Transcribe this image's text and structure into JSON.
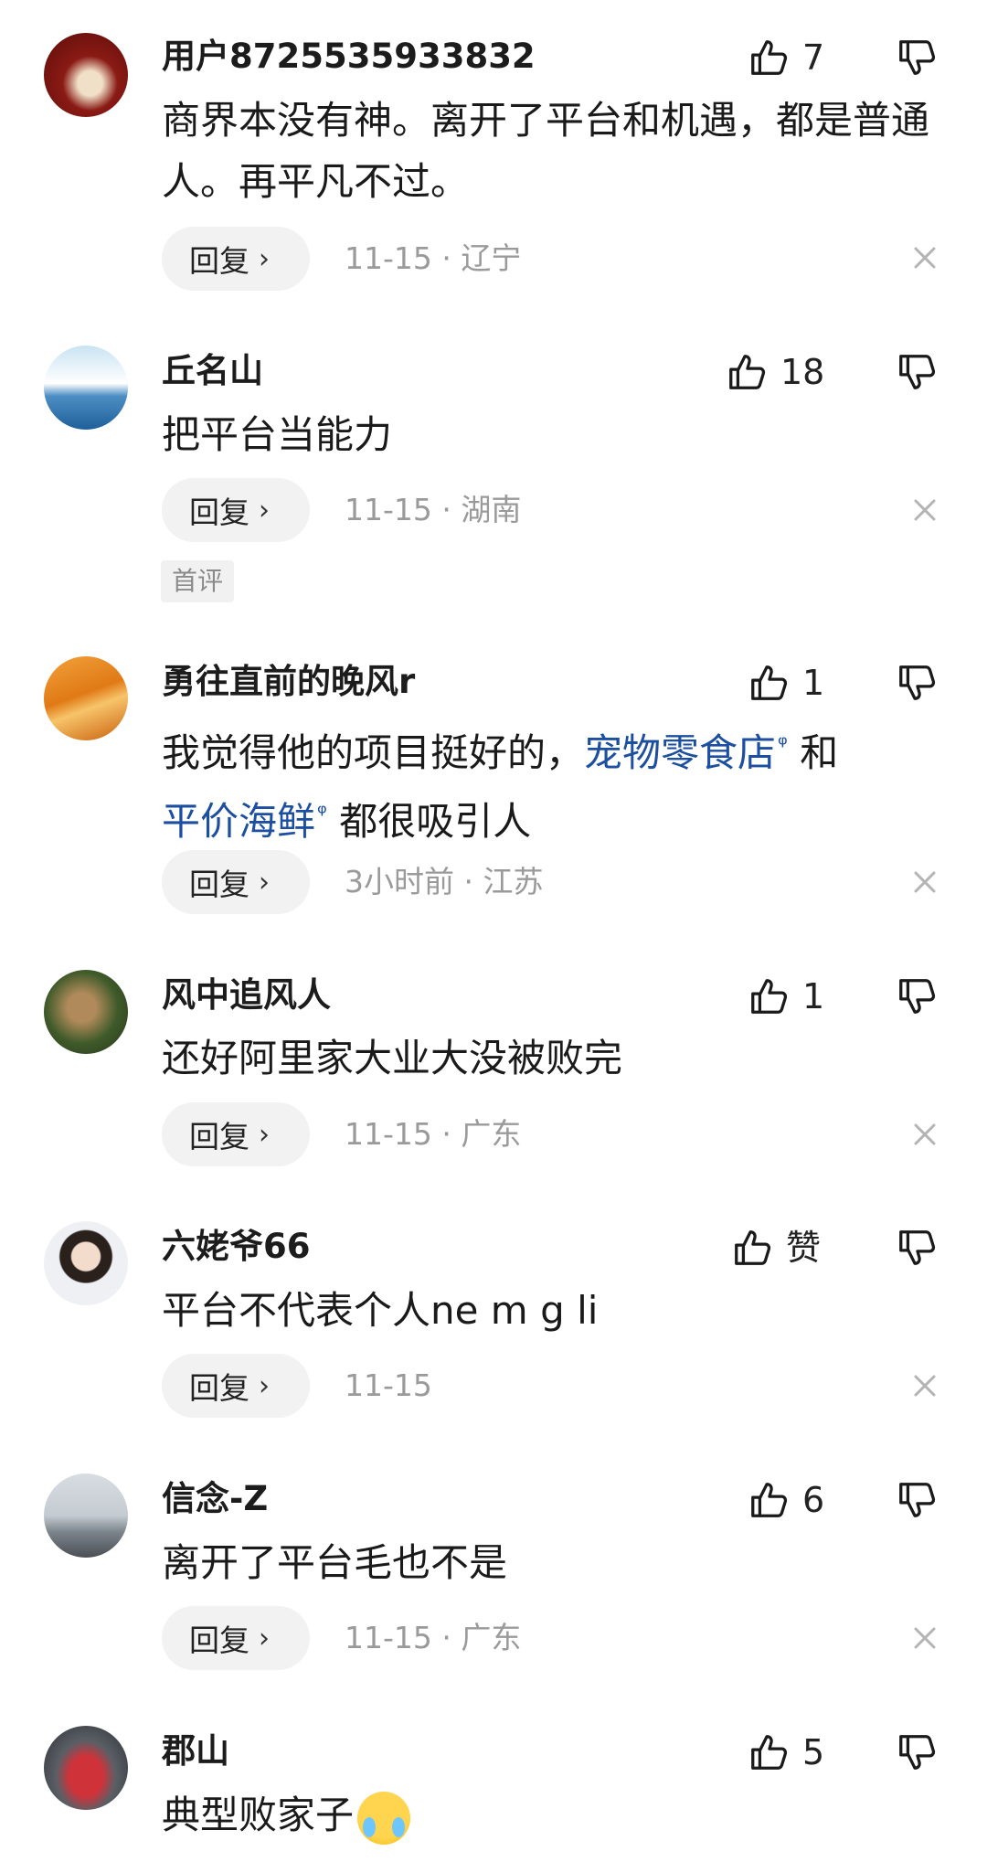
{
  "comments": [
    {
      "user": "用户8725535933832",
      "text": "商界本没有神。离开了平台和机遇，都是普通人。再平凡不过。",
      "likes": "7",
      "reply": "回复",
      "meta": "11-15 · 辽宁"
    },
    {
      "user": "丘名山",
      "text": "把平台当能力",
      "likes": "18",
      "reply": "回复",
      "meta": "11-15 · 湖南",
      "tag": "首评"
    },
    {
      "user": "勇往直前的晚风r",
      "text_parts": [
        "我觉得他的项目挺好的，",
        "宠物零食店",
        "和",
        "平价海鲜",
        "都很吸引人"
      ],
      "likes": "1",
      "reply": "回复",
      "meta": "3小时前 · 江苏"
    },
    {
      "user": "风中追风人",
      "text": "还好阿里家大业大没被败完",
      "likes": "1",
      "reply": "回复",
      "meta": "11-15 · 广东"
    },
    {
      "user": "六姥爷66",
      "text": "平台不代表个人ne m g li",
      "likes": "赞",
      "reply": "回复",
      "meta": "11-15"
    },
    {
      "user": "信念-Z",
      "text": "离开了平台毛也不是",
      "likes": "6",
      "reply": "回复",
      "meta": "11-15 · 广东"
    },
    {
      "user": "郡山",
      "text": "典型败家子",
      "likes": "5"
    }
  ],
  "icons": {
    "like": "thumbs-up-icon",
    "dislike": "thumbs-down-icon",
    "close": "close-icon",
    "search": "search-icon",
    "chevron": "chevron-right-icon",
    "emoji": "crying-face-emoji"
  },
  "colors": {
    "link": "#1d4fa0",
    "meta": "#9a9a9a",
    "reply_bg": "#f2f2f2"
  }
}
